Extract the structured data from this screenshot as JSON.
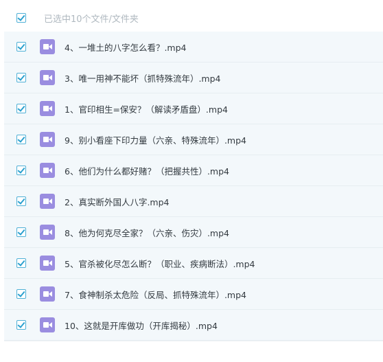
{
  "header": {
    "selected_count_text": "已选中10个文件/文件夹",
    "select_all_checked": true
  },
  "files": [
    {
      "name": "4、一堆土的八字怎么看？.mp4",
      "checked": true,
      "icon": "video-icon"
    },
    {
      "name": "3、唯一用神不能坏（抓特殊流年）.mp4",
      "checked": true,
      "icon": "video-icon"
    },
    {
      "name": "1、官印相生=保安？（解读矛盾盘）.mp4",
      "checked": true,
      "icon": "video-icon"
    },
    {
      "name": "9、别小看座下印力量（六亲、特殊流年）.mp4",
      "checked": true,
      "icon": "video-icon"
    },
    {
      "name": "6、他们为什么都好赌？（把握共性）.mp4",
      "checked": true,
      "icon": "video-icon"
    },
    {
      "name": "2、真实断外国人八字.mp4",
      "checked": true,
      "icon": "video-icon"
    },
    {
      "name": "8、他为何克尽全家？（六亲、伤灾）.mp4",
      "checked": true,
      "icon": "video-icon"
    },
    {
      "name": "5、官杀被化尽怎么断？（职业、疾病断法）.mp4",
      "checked": true,
      "icon": "video-icon"
    },
    {
      "name": "7、食神制杀太危险（反局、抓特殊流年）.mp4",
      "checked": true,
      "icon": "video-icon"
    },
    {
      "name": "10、这就是开库做功（开库揭秘）.mp4",
      "checked": true,
      "icon": "video-icon"
    }
  ],
  "colors": {
    "accent": "#2aa0cf",
    "row_background": "#f3f8fb",
    "video_icon": "#9a8de0"
  }
}
